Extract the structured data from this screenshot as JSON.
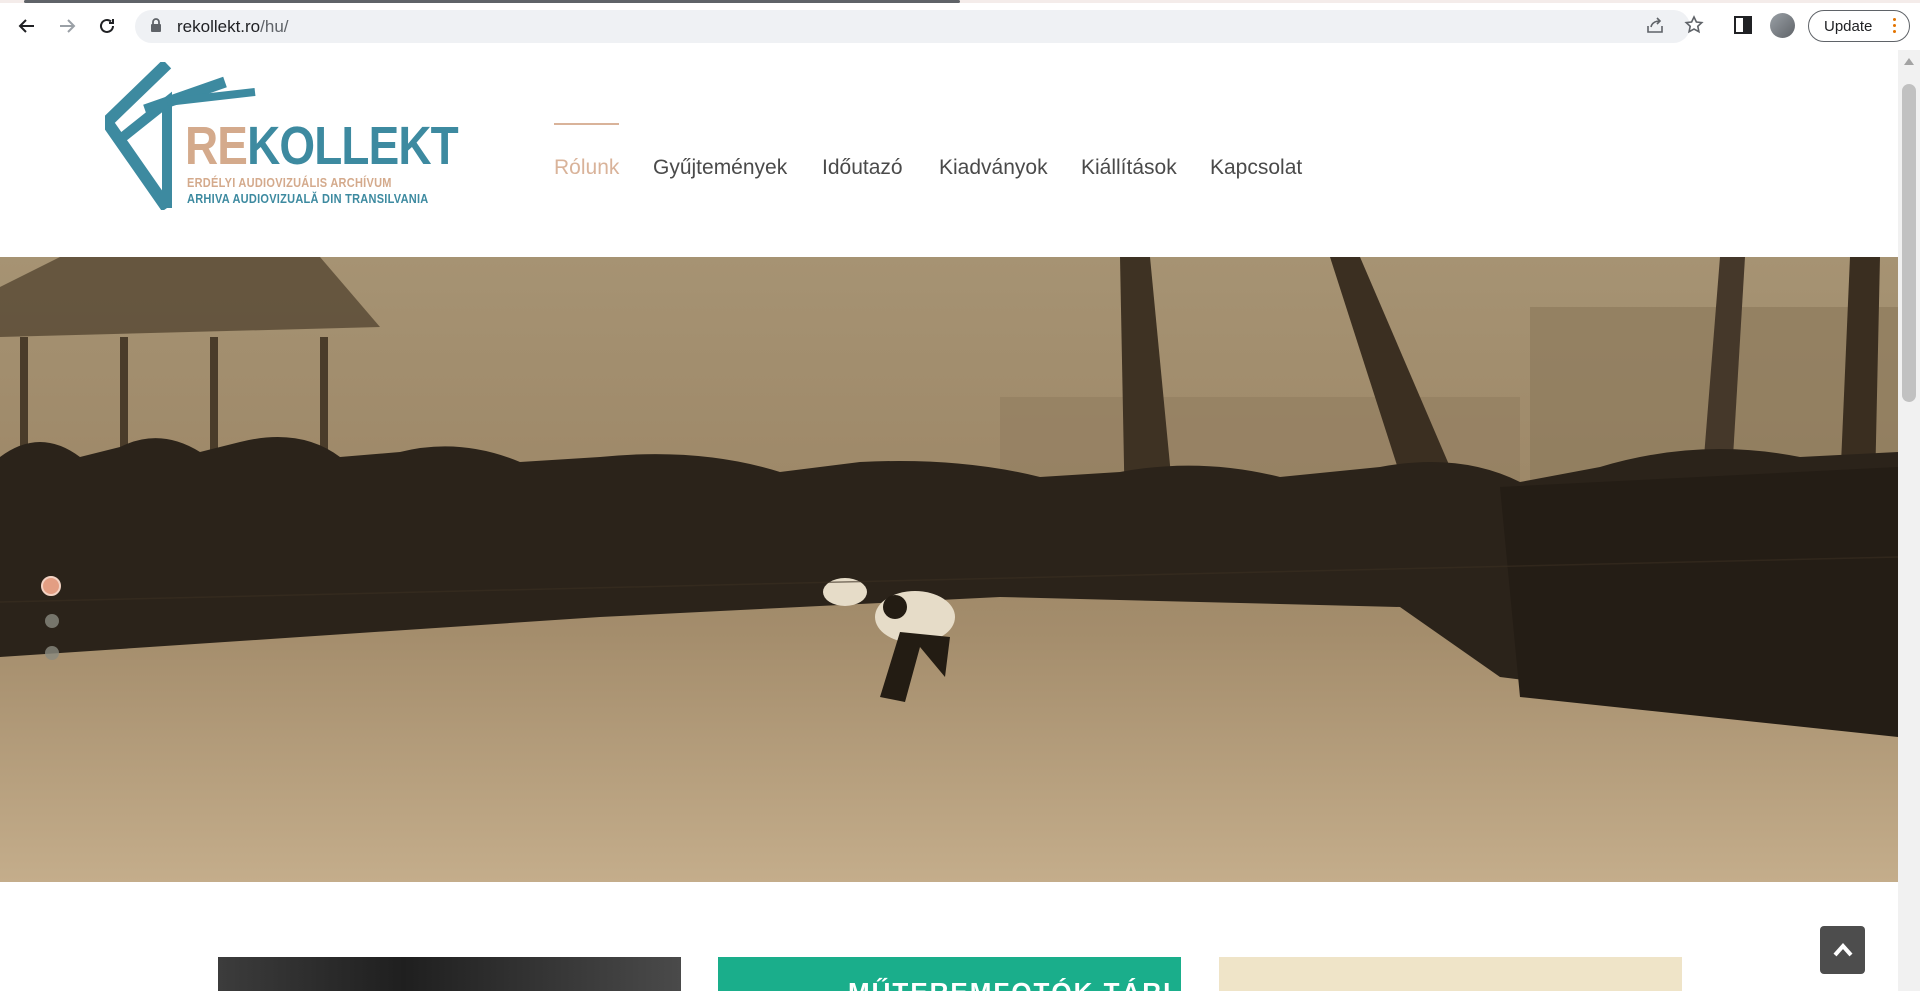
{
  "browser": {
    "url_host": "rekollekt.ro",
    "url_path": "/hu/",
    "update_label": "Update"
  },
  "logo": {
    "re": "RE",
    "kollekt": "KOLLEKT",
    "subtitle_hu": "ERDÉLYI AUDIOVIZUÁLIS ARCHÍVUM",
    "subtitle_ro": "ARHIVA AUDIOVIZUALĂ DIN TRANSILVANIA"
  },
  "menu": {
    "items": [
      {
        "label": "Rólunk",
        "active": true
      },
      {
        "label": "Gyűjtemények",
        "active": false
      },
      {
        "label": "Időutazó",
        "active": false
      },
      {
        "label": "Kiadványok",
        "active": false
      },
      {
        "label": "Kiállítások",
        "active": false
      },
      {
        "label": "Kapcsolat",
        "active": false
      }
    ]
  },
  "slider": {
    "slide_count": 3,
    "active_index": 0
  },
  "cards": {
    "middle_heading": "MŰTEREMFOTÓK TÁRLATA"
  },
  "colors": {
    "accent_beige": "#d9b39a",
    "brand_teal": "#3d8aa0",
    "card_green": "#1aae8b"
  },
  "icons": {
    "back": "arrow-left-icon",
    "forward": "arrow-right-icon",
    "reload": "reload-icon",
    "lock": "lock-icon",
    "share": "share-icon",
    "bookmark": "star-icon",
    "side_panel": "side-panel-icon",
    "scroll_top": "chevron-up-icon"
  }
}
